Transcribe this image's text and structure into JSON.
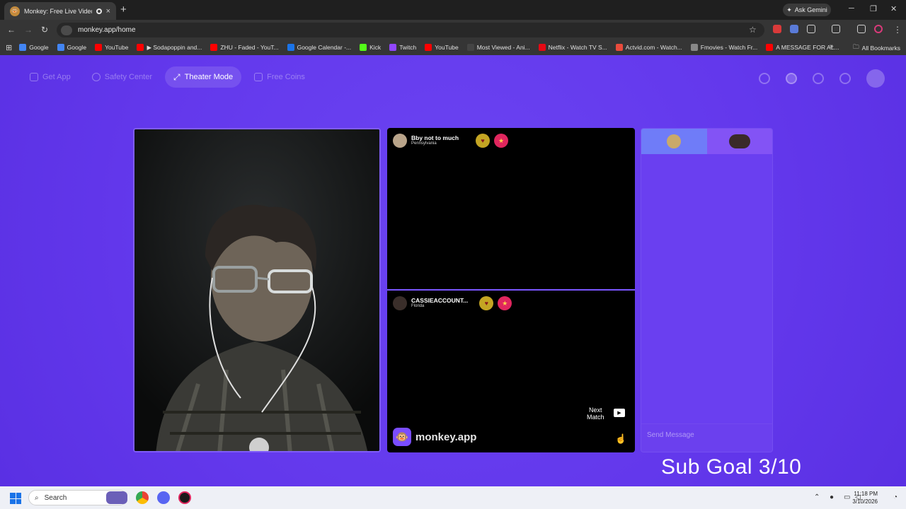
{
  "browser": {
    "tab_title": "Monkey: Free Live Video Ch",
    "tab_close": "×",
    "new_tab": "+",
    "ask_gemini": "Ask Gemini",
    "url": "monkey.app/home",
    "bookmarks": [
      {
        "label": "Google",
        "color": "#4285f4"
      },
      {
        "label": "Google",
        "color": "#4285f4"
      },
      {
        "label": "YouTube",
        "color": "#ff0000"
      },
      {
        "label": "▶ Sodapoppin and...",
        "color": "#ff0000"
      },
      {
        "label": "ZHU - Faded - YouT...",
        "color": "#ff0000"
      },
      {
        "label": "Google Calendar -...",
        "color": "#1a73e8"
      },
      {
        "label": "Kick",
        "color": "#53fc18"
      },
      {
        "label": "Twitch",
        "color": "#9146ff"
      },
      {
        "label": "YouTube",
        "color": "#ff0000"
      },
      {
        "label": "Most Viewed - Ani...",
        "color": "#444444"
      },
      {
        "label": "Netflix - Watch TV S...",
        "color": "#e50914"
      },
      {
        "label": "Actvid.com - Watch...",
        "color": "#e94b3c"
      },
      {
        "label": "Fmovies - Watch Fr...",
        "color": "#888888"
      },
      {
        "label": "A MESSAGE FOR AL...",
        "color": "#ff0000"
      }
    ],
    "all_bookmarks": "All Bookmarks"
  },
  "nav": {
    "get_app": "Get App",
    "safety_center": "Safety Center",
    "theater_mode": "Theater Mode",
    "free_coins": "Free Coins"
  },
  "match1": {
    "name": "Bby not to much",
    "location": "Pennsylvania"
  },
  "match2": {
    "name": "CASSIEACCOUNT...",
    "location": "Florida"
  },
  "next_match": {
    "line1": "Next",
    "line2": "Match"
  },
  "brand": "monkey.app",
  "chat": {
    "placeholder": "Send Message"
  },
  "overlay": {
    "sub_goal": "Sub Goal 3/10"
  },
  "taskbar": {
    "search": "Search",
    "time": "11:18 PM",
    "date": "3/10/2026"
  },
  "colors": {
    "accent": "#6a3ff0",
    "heart_badge": "#c4a523",
    "gift_badge": "#e0265e"
  }
}
